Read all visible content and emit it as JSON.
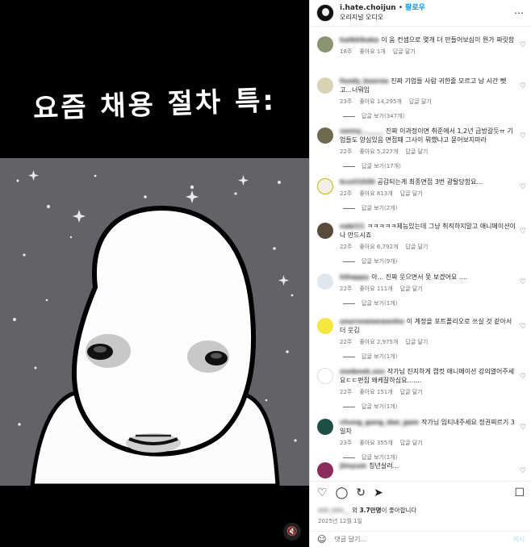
{
  "media": {
    "caption": "요즘 채용 절차 특:"
  },
  "header": {
    "username": "i.hate.choijun",
    "dot": "•",
    "follow": "팔로우",
    "audio": "오리지널 오디오",
    "more_icon": "more-horizontal-icon"
  },
  "comments": [
    {
      "user": "kaikkikaka",
      "text": "이 움 컨셉으로 몇개 더 만들어보심이 뭔가 짜릿함",
      "time": "18주",
      "likes": "좋아요 1개",
      "reply": "답글 달기",
      "replies": "",
      "avatar_color": "#8a9470"
    },
    {
      "user": "foody_koorea",
      "text": "진짜 기업들 사람 귀한줄 모르고 남 시간 뺏고...너뭐임",
      "time": "23주",
      "likes": "좋아요 14,295개",
      "reply": "답글 달기",
      "replies": "답글 보기(347개)",
      "avatar_color": "#d9d2b4"
    },
    {
      "user": "sonny_._____",
      "text": "진짜 이과정이면 취준에서 1,2년 금방갈듯ㅠ 기업들도 양심있음 면접때 그사이 뭐했냐고 묻어보지마라",
      "time": "22주",
      "likes": "좋아요 5,227개",
      "reply": "답글 달기",
      "replies": "답글 보기(17개)",
      "avatar_color": "#6e6a4f"
    },
    {
      "user": "kco31030",
      "text": "공감되는게 최종면접 3번 광탈당함요...",
      "time": "22주",
      "likes": "좋아요 813개",
      "reply": "답글 달기",
      "replies": "답글 보기(2개)",
      "avatar_color": "#f2f0e6"
    },
    {
      "user": "nabi11",
      "text": "ㅋㅋㅋㅋㅋ제능있는데 그냥 취직하지말고 애니메이션이나 만드시죠",
      "time": "22주",
      "likes": "좋아요 6,792개",
      "reply": "답글 달기",
      "replies": "답글 보기(9개)",
      "avatar_color": "#5a4a3c"
    },
    {
      "user": "hihappy",
      "text": "아... 진짜 웃으면서 못 보겠어요 ....",
      "time": "22주",
      "likes": "좋아요 111개",
      "reply": "답글 달기",
      "replies": "답글 보기(1개)",
      "avatar_color": "#dfe7ee"
    },
    {
      "user": "yoursnamewonho",
      "text": "이 계정을 포트폴리오로 쓰실 것 같아서 더 웃김",
      "time": "22주",
      "likes": "좋아요 2,975개",
      "reply": "답글 달기",
      "replies": "답글 보기(1개)",
      "avatar_color": "#f5e642"
    },
    {
      "user": "zoobook.oss",
      "text": "작가님 진지하게 캡컷 애니메이션 강의열어주세요ㄷㄷ편집 왜케잘하심요.......",
      "time": "22주",
      "likes": "좋아요 151개",
      "reply": "답글 달기",
      "replies": "답글 보기(1개)",
      "avatar_color": "#ffffff"
    },
    {
      "user": "chung_gang_dae_gam",
      "text": "작가님 임티내주세요 정권찌르기 3일차",
      "time": "23주",
      "likes": "좋아요 355개",
      "reply": "답글 달기",
      "replies": "답글 보기(1개)",
      "avatar_color": "#1f4f44"
    },
    {
      "user": "jiinyum",
      "text": "칭년살려...",
      "time": "",
      "likes": "",
      "reply": "",
      "replies": "",
      "avatar_color": "#8c2c5c"
    }
  ],
  "actions": {
    "like_icon": "heart-icon",
    "comment_icon": "comment-icon",
    "share_icon": "share-icon",
    "send_icon": "send-icon",
    "save_icon": "bookmark-icon"
  },
  "likes": {
    "blurred_user": "min_kim__",
    "text_prefix": "외 ",
    "count": "3.7만명",
    "text_suffix": "이 좋아합니다"
  },
  "post_date": "2025년 12월 1일",
  "add_comment": {
    "placeholder": "댓글 달기...",
    "post_label": "게시"
  }
}
